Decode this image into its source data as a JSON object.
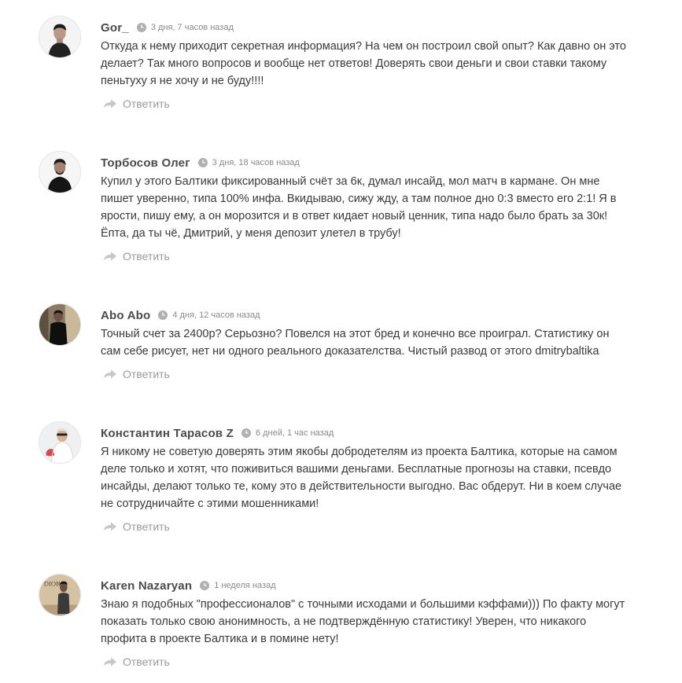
{
  "comments": [
    {
      "author": "Gor_",
      "time": "3 дня, 7 часов назад",
      "text": "Откуда к нему приходит секретная информация? На чем он построил свой опыт? Как давно он это делает? Так много вопросов и вообще нет ответов! Доверять свои деньги и свои ставки такому пеньтуху я не хочу и не буду!!!!",
      "reply_label": "Ответить"
    },
    {
      "author": "Торбосов Олег",
      "time": "3 дня, 18 часов назад",
      "text": "Купил у этого Балтики фиксированный счёт за 6к, думал инсайд, мол матч в кармане. Он мне пишет уверенно, типа 100% инфа. Вкидываю, сижу жду, а там полное дно 0:3 вместо его 2:1! Я в ярости, пишу ему, а он морозится и в ответ кидает новый ценник, типа надо было брать за 30к! Ёпта, да ты чё, Дмитрий, у меня депозит улетел в трубу!",
      "reply_label": "Ответить"
    },
    {
      "author": "Abo Abo",
      "time": "4 дня, 12 часов назад",
      "text": "Точный счет за 2400р? Серьозно? Повелся на этот бред и конечно все проиграл. Статистику он сам себе рисует, нет ни одного реального доказателства. Чистый развод от этого dmitrybaltika",
      "reply_label": "Ответить"
    },
    {
      "author": "Константин Тарасов Z",
      "time": "6 дней, 1 час назад",
      "text": "Я никому не советую доверять этим якобы добродетелям из проекта Балтика, которые на самом деле только и хотят, что поживиться вашими деньгами. Бесплатные прогнозы на ставки, псевдо инсайды, делают только те, кому это в действительности выгодно. Вас обдерут. Ни в коем случае не сотрудничайте с этими мошенниками!",
      "reply_label": "Ответить"
    },
    {
      "author": "Karen Nazaryan",
      "time": "1 неделя назад",
      "text": "Знаю я подобных \"профессионалов\" с точными исходами и большими кэффами))) По факту могут показать только свою анонимность, а не подтверждённую статистику! Уверен, что никакого профита в проекте Балтика и в помине нету!",
      "avatar_text": "DIOR",
      "reply_label": "Ответить"
    }
  ]
}
